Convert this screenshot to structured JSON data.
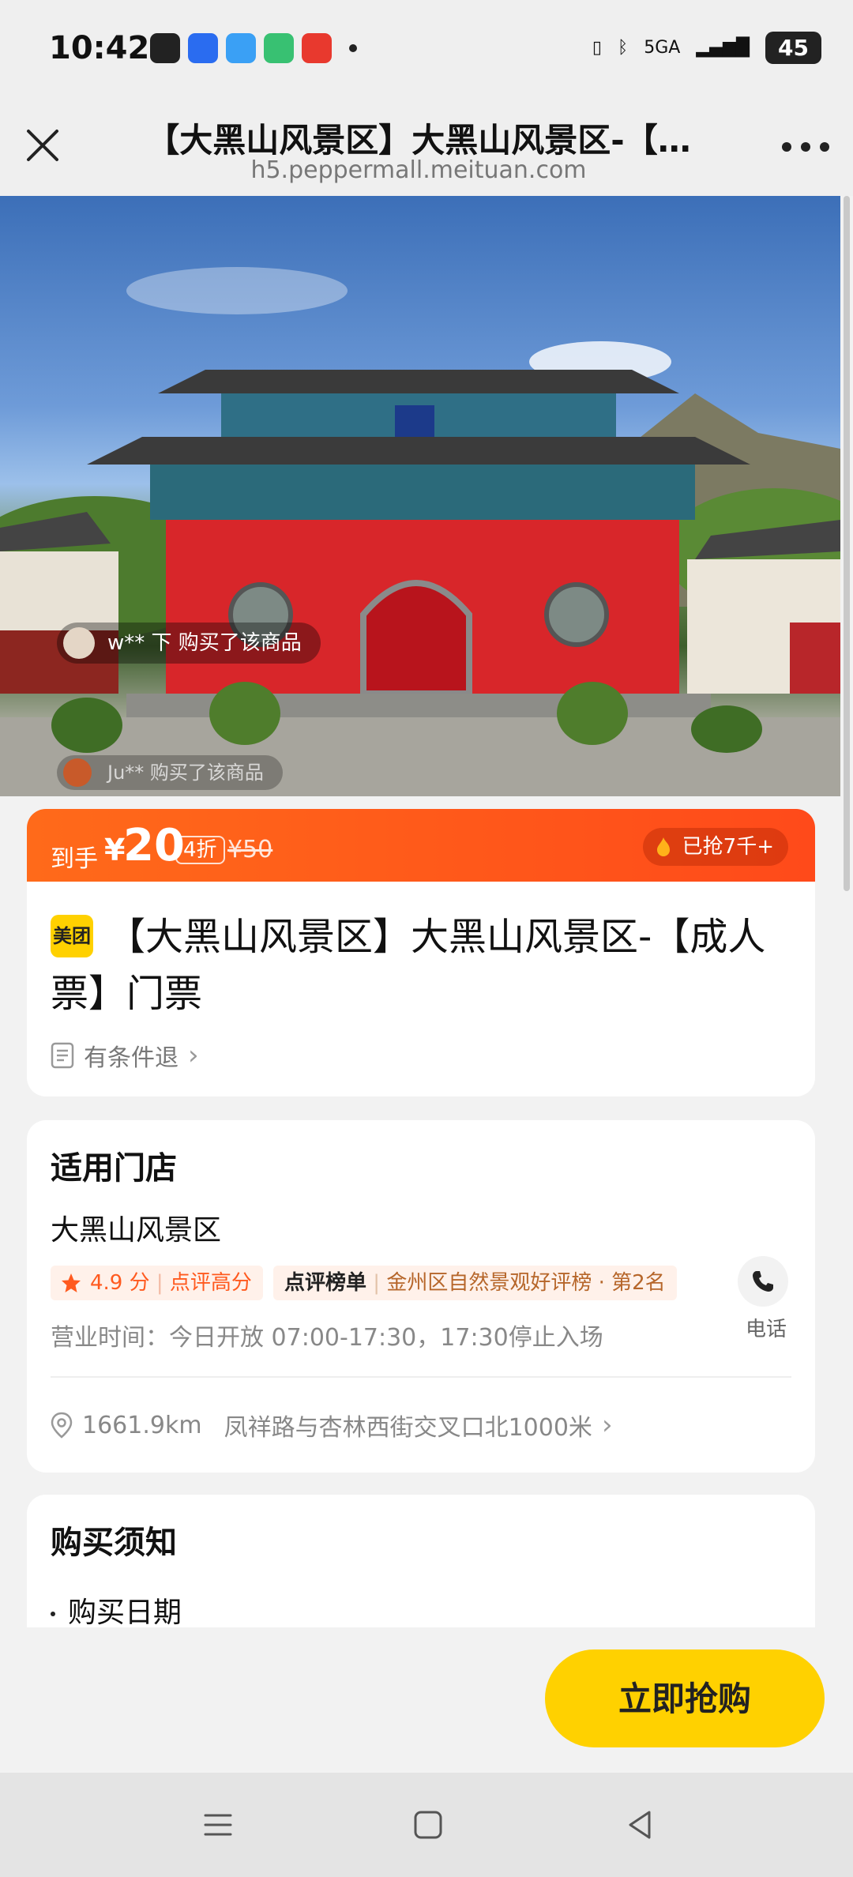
{
  "status_bar": {
    "time": "10:42",
    "network": "5GA",
    "battery": "45"
  },
  "nav": {
    "title": "【大黑山风景区】大黑山风景区-【…",
    "url": "h5.peppermall.meituan.com"
  },
  "hero": {
    "buyer_notice": "w** 下 购买了该商品",
    "buyer_notice_2": "Ju** 购买了该商品"
  },
  "price_bar": {
    "label": "到手",
    "currency": "¥",
    "price": "20",
    "discount": "4折",
    "original_price": "¥50",
    "sold": "已抢7千+"
  },
  "product": {
    "badge": "美团",
    "title": "【大黑山风景区】大黑山风景区-【成人票】门票",
    "refund_policy": "有条件退"
  },
  "store_section": {
    "title": "适用门店",
    "store_name": "大黑山风景区",
    "rating": "4.9 分",
    "rating_tag": "点评高分",
    "rank_label": "点评榜单",
    "rank_text": "金州区自然景观好评榜 · 第2名",
    "hours": "营业时间：今日开放 07:00-17:30，17:30停止入场",
    "phone_label": "电话",
    "distance": "1661.9km",
    "address": "凤祥路与杏林西街交叉口北1000米"
  },
  "notice_section": {
    "title": "购买须知",
    "first_item": "购买日期"
  },
  "action": {
    "buy_label": "立即抢购"
  },
  "colors": {
    "accent_orange": "#ff5a1f",
    "buy_yellow": "#ffd100"
  }
}
